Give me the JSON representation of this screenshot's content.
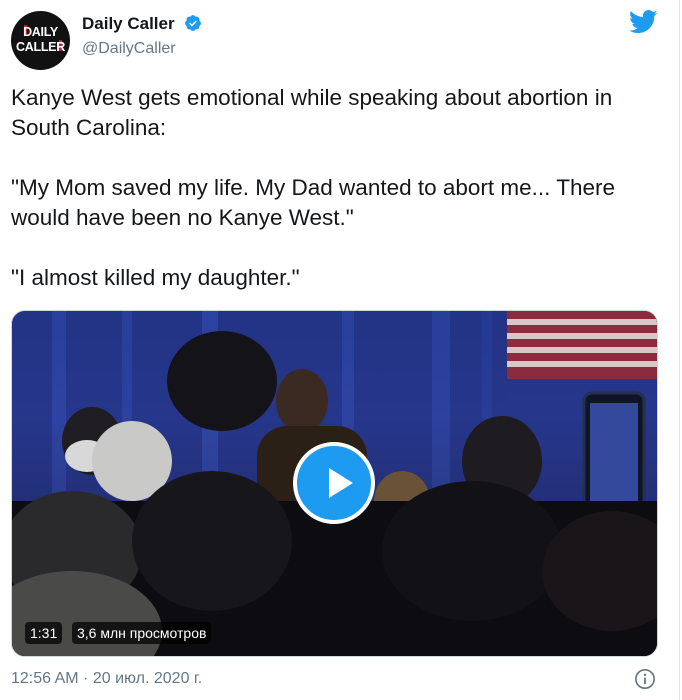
{
  "account": {
    "name": "Daily Caller",
    "handle": "@DailyCaller",
    "avatar_text_line1": "DAILY",
    "avatar_text_line2": "CALLER",
    "verified": true
  },
  "tweet": {
    "paragraphs": [
      "Kanye West gets emotional while speaking about abortion in South Carolina:",
      "\"My Mom saved my life. My Dad wanted to abort me... There would have been no Kanye West.\"",
      "\"I almost killed my daughter.\""
    ],
    "timestamp": "12:56 AM · 20 июл. 2020 г."
  },
  "video": {
    "duration": "1:31",
    "views": "3,6 млн просмотров"
  },
  "icons": {
    "brand": "twitter-bird-icon",
    "verified": "verified-badge-icon",
    "play": "play-icon",
    "info": "info-icon"
  },
  "colors": {
    "accent": "#1d9bf0",
    "secondary_text": "#657786",
    "text": "#14171a",
    "brand_red": "#d11d25"
  }
}
